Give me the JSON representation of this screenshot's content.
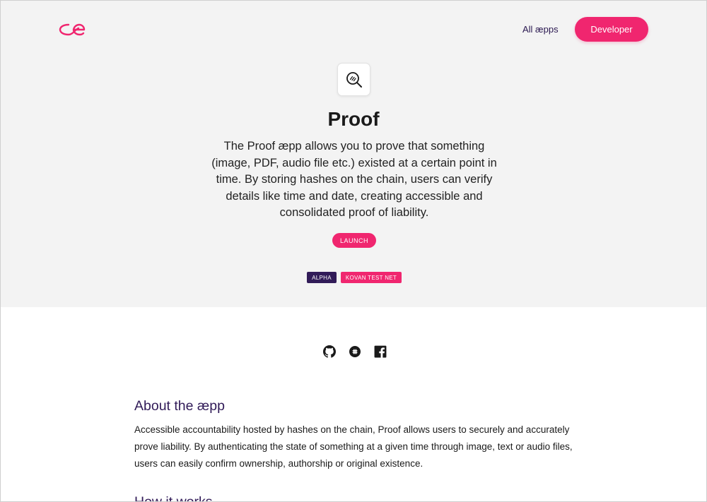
{
  "header": {
    "nav_link": "All æpps",
    "developer_button": "Developer"
  },
  "app": {
    "title": "Proof",
    "description": "The Proof æpp allows you to prove that something (image, PDF, audio file etc.) existed at a certain point in time. By storing hashes on the chain, users can verify details like time and date, creating accessible and consolidated proof of liability.",
    "launch_button": "LAUNCH",
    "badges": [
      "ALPHA",
      "KOVAN TEST NET"
    ]
  },
  "colors": {
    "accent": "#f0266f",
    "dark_purple": "#311b58",
    "hero_bg": "#f3f3f3"
  },
  "social_icons": [
    "github-icon",
    "slack-icon",
    "facebook-icon"
  ],
  "about": {
    "heading": "About the æpp",
    "body": "Accessible accountability hosted by hashes on the chain, Proof allows users to securely and accurately prove liability. By authenticating the state of something at a given time through image, text or audio files, users can easily confirm ownership, authorship or original existence."
  },
  "next_section": {
    "heading": "How it works"
  }
}
